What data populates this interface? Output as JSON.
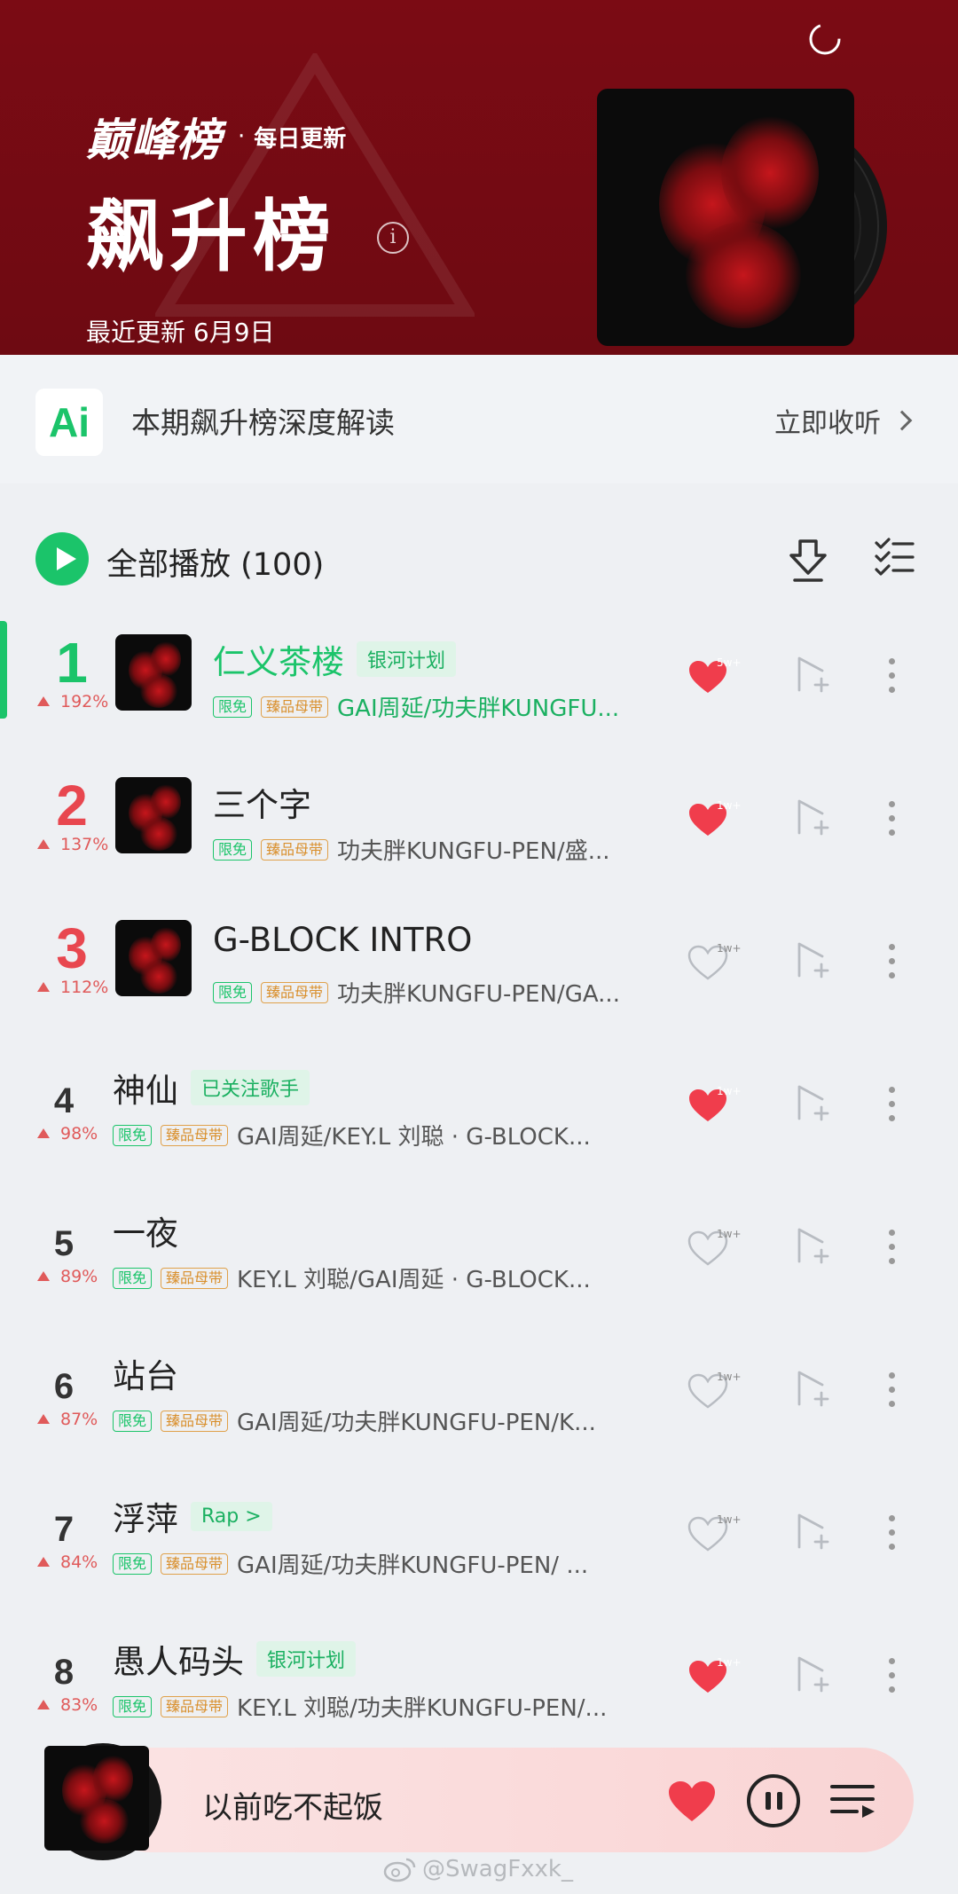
{
  "header": {
    "brand": "巅峰榜",
    "dot": "·",
    "frequency": "每日更新",
    "title": "飙升榜",
    "info_icon": "i",
    "update_text": "最近更新 6月9日"
  },
  "ai_bar": {
    "logo": "Ai",
    "text": "本期飙升榜深度解读",
    "action": "立即收听"
  },
  "play_all": {
    "label": "全部播放 (100)"
  },
  "songs": [
    {
      "rank": "1",
      "change": "192%",
      "title": "仁义茶楼",
      "tag": "银河计划",
      "free": "限免",
      "master": "臻品母带",
      "artists": "GAI周延/功夫胖KUNGFU...",
      "likes": "5w+",
      "liked": true,
      "playing": true,
      "has_thumb": true
    },
    {
      "rank": "2",
      "change": "137%",
      "title": "三个字",
      "tag": "",
      "free": "限免",
      "master": "臻品母带",
      "artists": "功夫胖KUNGFU-PEN/盛...",
      "likes": "1w+",
      "liked": true,
      "playing": false,
      "has_thumb": true
    },
    {
      "rank": "3",
      "change": "112%",
      "title": "G-BLOCK INTRO",
      "tag": "",
      "free": "限免",
      "master": "臻品母带",
      "artists": "功夫胖KUNGFU-PEN/GA...",
      "likes": "1w+",
      "liked": false,
      "playing": false,
      "has_thumb": true
    },
    {
      "rank": "4",
      "change": "98%",
      "title": "神仙",
      "tag": "已关注歌手",
      "free": "限免",
      "master": "臻品母带",
      "artists": "GAI周延/KEY.L 刘聪 · G-BLOCK...",
      "likes": "1w+",
      "liked": true,
      "playing": false,
      "has_thumb": false
    },
    {
      "rank": "5",
      "change": "89%",
      "title": "一夜",
      "tag": "",
      "free": "限免",
      "master": "臻品母带",
      "artists": "KEY.L 刘聪/GAI周延 · G-BLOCK...",
      "likes": "1w+",
      "liked": false,
      "playing": false,
      "has_thumb": false
    },
    {
      "rank": "6",
      "change": "87%",
      "title": "站台",
      "tag": "",
      "free": "限免",
      "master": "臻品母带",
      "artists": "GAI周延/功夫胖KUNGFU-PEN/K...",
      "likes": "1w+",
      "liked": false,
      "playing": false,
      "has_thumb": false
    },
    {
      "rank": "7",
      "change": "84%",
      "title": "浮萍",
      "tag": "Rap >",
      "free": "限免",
      "master": "臻品母带",
      "artists": "GAI周延/功夫胖KUNGFU-PEN/ ...",
      "likes": "1w+",
      "liked": false,
      "playing": false,
      "has_thumb": false
    },
    {
      "rank": "8",
      "change": "83%",
      "title": "愚人码头",
      "tag": "银河计划",
      "free": "限免",
      "master": "臻品母带",
      "artists": "KEY.L 刘聪/功夫胖KUNGFU-PEN/...",
      "likes": "1w+",
      "liked": true,
      "playing": false,
      "has_thumb": false
    }
  ],
  "player": {
    "title": "以前吃不起饭"
  },
  "watermark": "@SwagFxxk_",
  "colors": {
    "header_bg": "#7b0b14",
    "accent_green": "#1bc46a",
    "top_rank_red": "#e8474f",
    "heart_red": "#f03d4c",
    "change_red": "#e05a5a"
  }
}
